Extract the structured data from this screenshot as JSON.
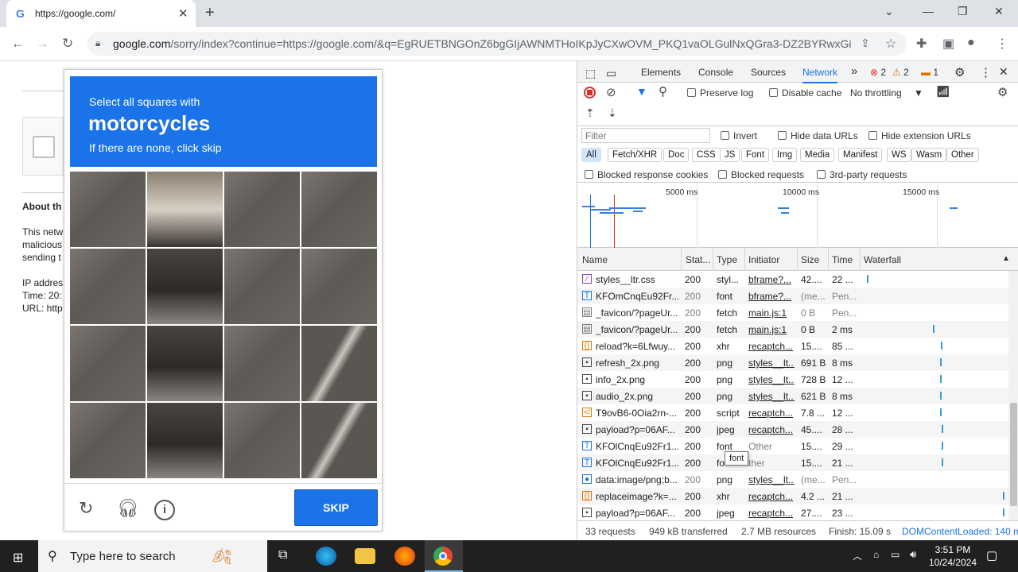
{
  "browser": {
    "tab_title": "https://google.com/",
    "tab_favicon": "G",
    "url_host": "google.com",
    "url_rest": "/sorry/index?continue=https://google.com/&q=EgRUETBNGOnZ6bgGIjAWNMTHoIKpJyCXwOVM_PKQ1vaOLGulNxQGra3-DZ2BYRwxGipf..."
  },
  "page": {
    "about_heading": "About th",
    "lines": [
      "This netw",
      "malicious",
      "sending t",
      "IP addres",
      "Time: 20:",
      "URL: http"
    ]
  },
  "captcha": {
    "line1": "Select all squares with",
    "line2": "motorcycles",
    "line3": "If there are none, click skip",
    "skip_label": "SKIP"
  },
  "devtools": {
    "tabs": [
      "Elements",
      "Console",
      "Sources",
      "Network"
    ],
    "more": "»",
    "errors": "2",
    "warnings": "2",
    "issues": "1",
    "preserve_log": "Preserve log",
    "disable_cache": "Disable cache",
    "throttling": "No throttling",
    "filter_placeholder": "Filter",
    "invert": "Invert",
    "hide_data_urls": "Hide data URLs",
    "hide_ext_urls": "Hide extension URLs",
    "chips": [
      "All",
      "Fetch/XHR",
      "Doc",
      "CSS",
      "JS",
      "Font",
      "Img",
      "Media",
      "Manifest",
      "WS",
      "Wasm",
      "Other"
    ],
    "blocked_cookies": "Blocked response cookies",
    "blocked_requests": "Blocked requests",
    "third_party": "3rd-party requests",
    "overview_labels": [
      "5000 ms",
      "10000 ms",
      "15000 ms"
    ],
    "columns": [
      "Name",
      "Stat...",
      "Type",
      "Initiator",
      "Size",
      "Time",
      "Waterfall"
    ],
    "rows": [
      {
        "icon": "css",
        "name": "styles__ltr.css",
        "status": "200",
        "type": "styl...",
        "init": "bframe?...",
        "size": "42....",
        "time": "22 ...",
        "link": true
      },
      {
        "icon": "font",
        "name": "KFOmCnqEu92Fr...",
        "status": "200",
        "type": "font",
        "init": "bframe?...",
        "size": "(me...",
        "time": "Pen...",
        "link": true,
        "gray": true
      },
      {
        "icon": "doc",
        "name": "_favicon/?pageUr...",
        "status": "200",
        "type": "fetch",
        "init": "main.js:1",
        "size": "0 B",
        "time": "Pen...",
        "link": true,
        "gray": true
      },
      {
        "icon": "doc",
        "name": "_favicon/?pageUr...",
        "status": "200",
        "type": "fetch",
        "init": "main.js:1",
        "size": "0 B",
        "time": "2 ms",
        "link": true
      },
      {
        "icon": "xhr",
        "name": "reload?k=6Lfwuy...",
        "status": "200",
        "type": "xhr",
        "init": "recaptch...",
        "size": "15....",
        "time": "85 ...",
        "link": true
      },
      {
        "icon": "img",
        "name": "refresh_2x.png",
        "status": "200",
        "type": "png",
        "init": "styles__lt...",
        "size": "691 B",
        "time": "8 ms",
        "link": true
      },
      {
        "icon": "img",
        "name": "info_2x.png",
        "status": "200",
        "type": "png",
        "init": "styles__lt...",
        "size": "728 B",
        "time": "12 ...",
        "link": true
      },
      {
        "icon": "img",
        "name": "audio_2x.png",
        "status": "200",
        "type": "png",
        "init": "styles__lt...",
        "size": "621 B",
        "time": "8 ms",
        "link": true
      },
      {
        "icon": "js",
        "name": "T9ovB6-0Oia2rn-...",
        "status": "200",
        "type": "script",
        "init": "recaptch...",
        "size": "7.8 ...",
        "time": "12 ...",
        "link": true
      },
      {
        "icon": "img",
        "name": "payload?p=06AF...",
        "status": "200",
        "type": "jpeg",
        "init": "recaptch...",
        "size": "45....",
        "time": "28 ...",
        "link": true
      },
      {
        "icon": "font",
        "name": "KFOlCnqEu92Fr1...",
        "status": "200",
        "type": "font",
        "init": "Other",
        "size": "15....",
        "time": "29 ...",
        "link": false
      },
      {
        "icon": "font",
        "name": "KFOlCnqEu92Fr1...",
        "status": "200",
        "type": "fo",
        "init": "ther",
        "size": "15....",
        "time": "21 ...",
        "link": false
      },
      {
        "icon": "data",
        "name": "data:image/png;b...",
        "status": "200",
        "type": "png",
        "init": "styles__lt...",
        "size": "(me...",
        "time": "Pen...",
        "link": true,
        "gray": true
      },
      {
        "icon": "xhr",
        "name": "replaceimage?k=...",
        "status": "200",
        "type": "xhr",
        "init": "recaptch...",
        "size": "4.2 ...",
        "time": "21 ...",
        "link": true
      },
      {
        "icon": "img",
        "name": "payload?p=06AF...",
        "status": "200",
        "type": "jpeg",
        "init": "recaptch...",
        "size": "27....",
        "time": "23 ...",
        "link": true
      }
    ],
    "tooltip": "font",
    "status_requests": "33 requests",
    "status_transferred": "949 kB transferred",
    "status_resources": "2.7 MB resources",
    "status_finish": "Finish: 15.09 s",
    "status_dcl": "DOMContentLoaded: 140 m"
  },
  "taskbar": {
    "search_placeholder": "Type here to search",
    "time": "3:51 PM",
    "date": "10/24/2024"
  }
}
